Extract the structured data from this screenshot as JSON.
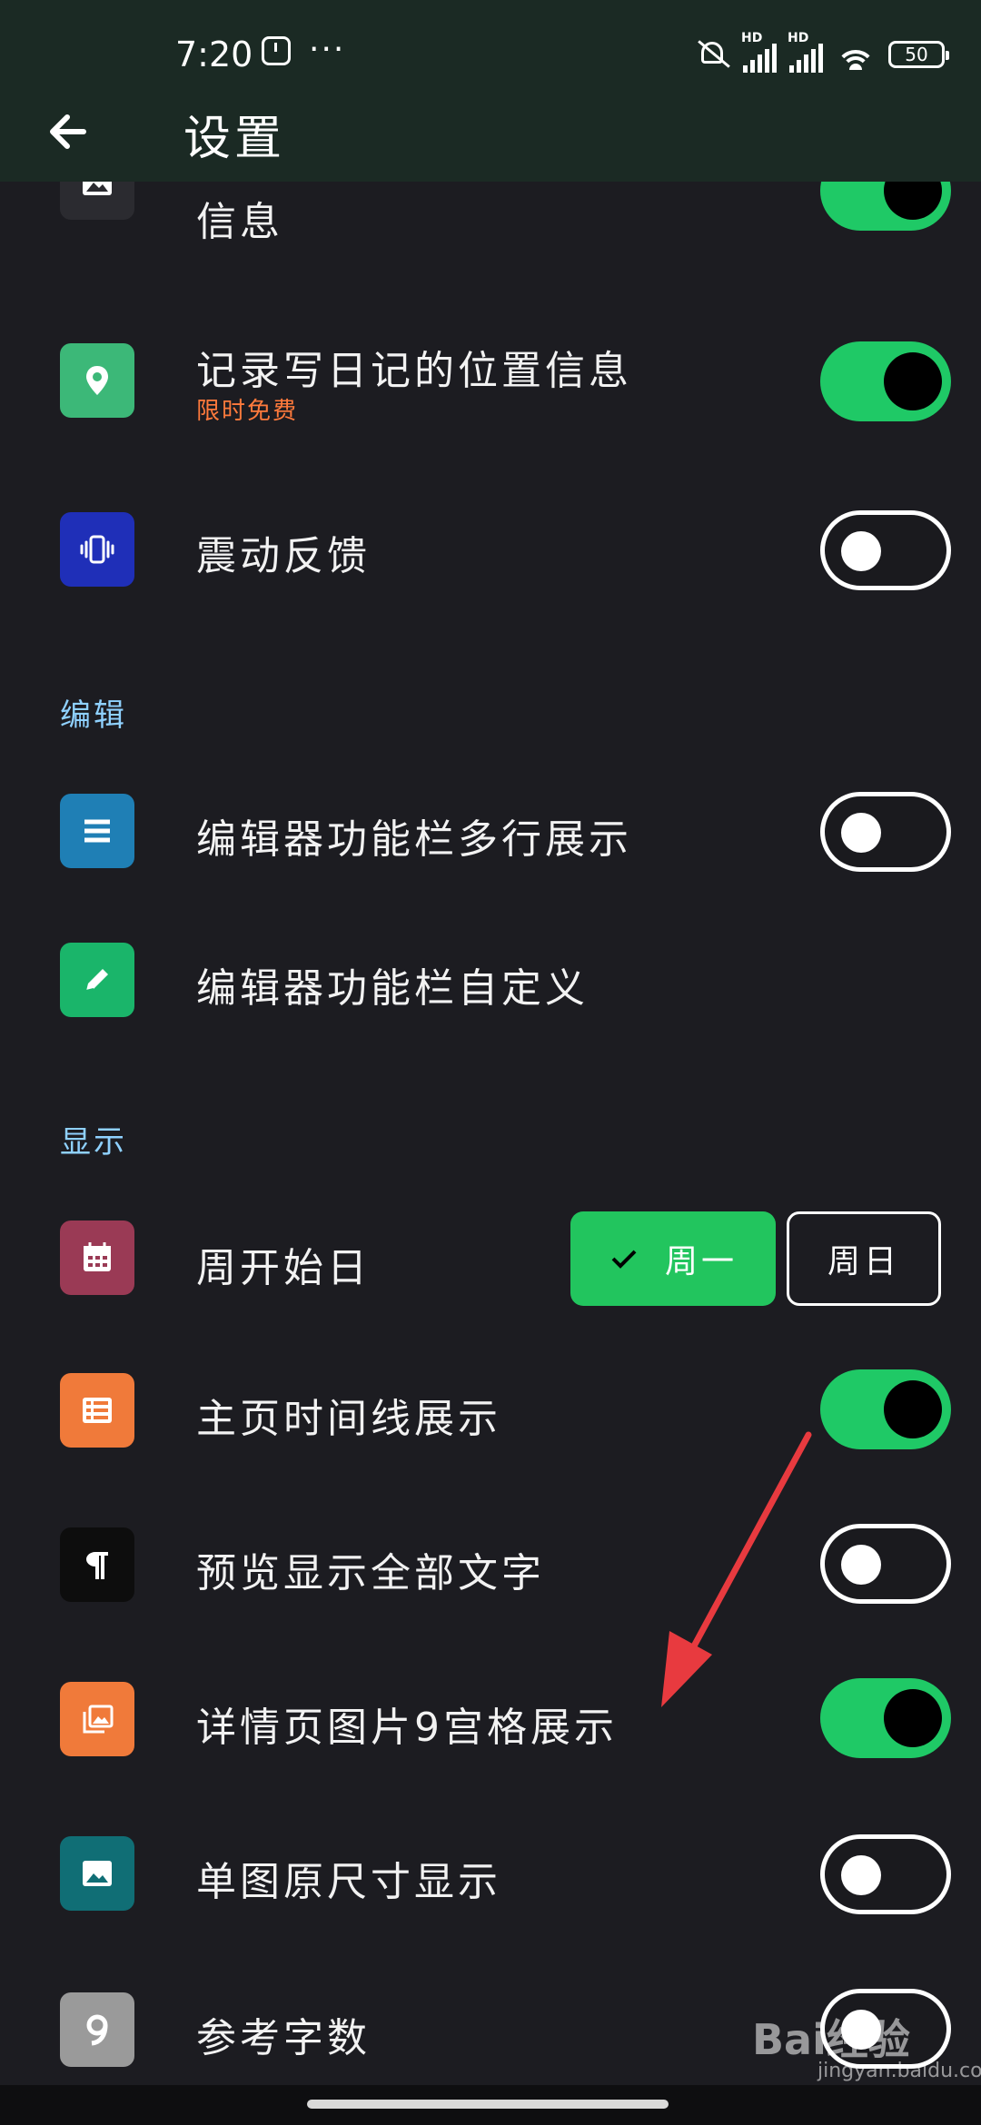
{
  "status_bar": {
    "time": "7:20",
    "dots": "···",
    "signal_label_1": "HD",
    "signal_label_2": "HD",
    "battery": "50"
  },
  "app_bar": {
    "title": "设置"
  },
  "rows": {
    "image_info": {
      "label": "信息",
      "toggle": "on",
      "icon": "image-icon",
      "color": "#2b2b30"
    },
    "location": {
      "label": "记录写日记的位置信息",
      "sub": "限时免费",
      "toggle": "on",
      "icon": "location-pin-icon",
      "color": "#3cb878"
    },
    "vibration": {
      "label": "震动反馈",
      "toggle": "off",
      "icon": "vibration-icon",
      "color": "#1f2fb8"
    },
    "toolbar_multiline": {
      "label": "编辑器功能栏多行展示",
      "toggle": "off",
      "icon": "menu-lines-icon",
      "color": "#1f7fb5"
    },
    "toolbar_custom": {
      "label": "编辑器功能栏自定义",
      "icon": "pencil-icon",
      "color": "#1ab56a"
    },
    "week_start": {
      "label": "周开始日",
      "icon": "calendar-icon",
      "color": "#9a3a55",
      "options": [
        "周一",
        "周日"
      ],
      "selected": "周一"
    },
    "timeline": {
      "label": "主页时间线展示",
      "toggle": "on",
      "icon": "list-icon",
      "color": "#f07a3a"
    },
    "preview_all": {
      "label": "预览显示全部文字",
      "toggle": "off",
      "icon": "paragraph-icon",
      "color": "#0d0d0d"
    },
    "grid9": {
      "label": "详情页图片9宫格展示",
      "toggle": "on",
      "icon": "gallery-icon",
      "color": "#f07a3a"
    },
    "single_image": {
      "label": "单图原尺寸显示",
      "toggle": "off",
      "icon": "image-icon",
      "color": "#106e75"
    },
    "word_count": {
      "label": "参考字数",
      "toggle": "off",
      "icon": "nine-icon",
      "color": "#9a9a9a"
    }
  },
  "sections": {
    "edit": "编辑",
    "display": "显示"
  },
  "watermark": {
    "brand": "Bai经验",
    "url": "jingyan.baidu.com"
  }
}
